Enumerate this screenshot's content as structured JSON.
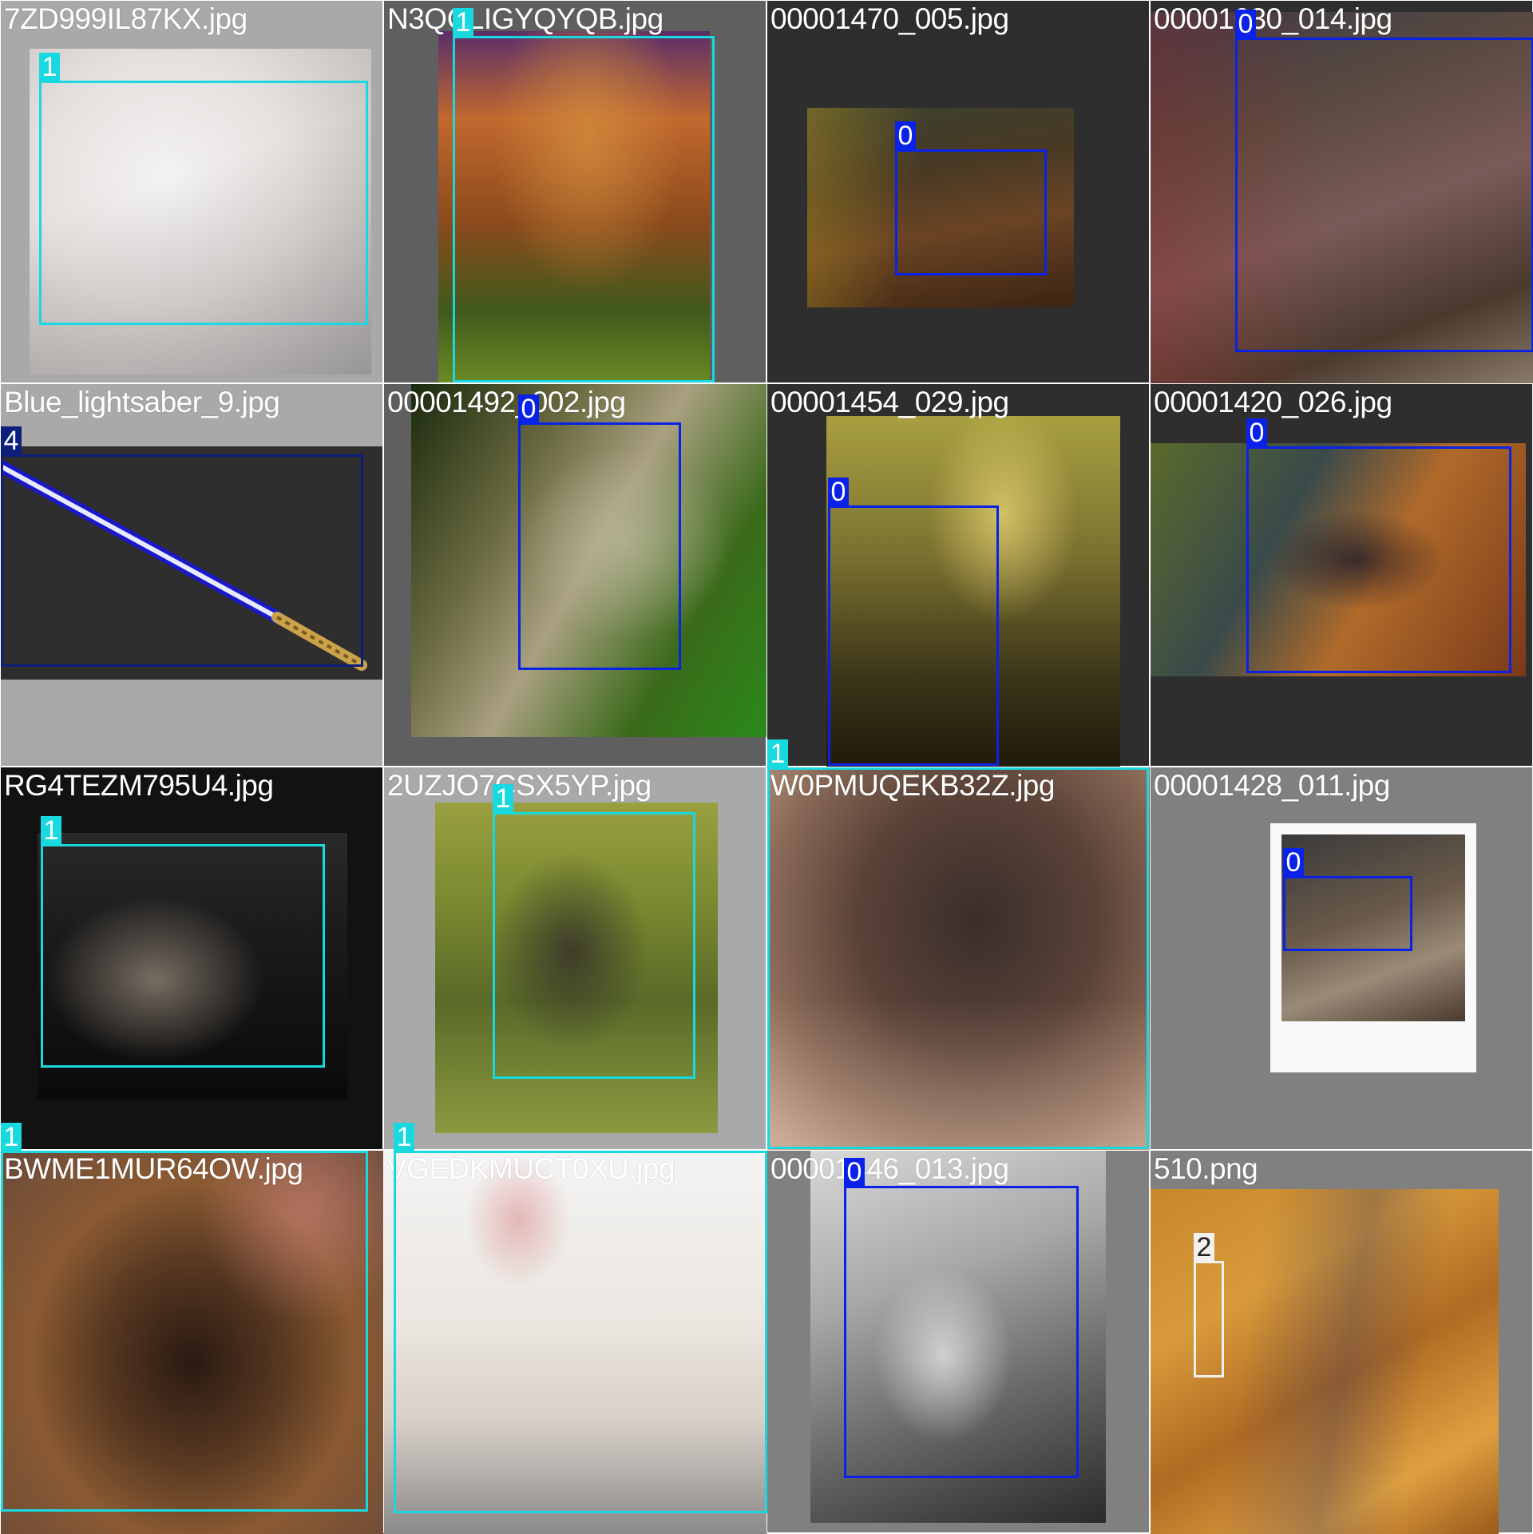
{
  "colors": {
    "cat_box": "#0a22e8",
    "dog_box": "#18d8e0",
    "lightsaber_box": "#0c1f7c",
    "person_box": "#f4f0f0"
  },
  "tiles": [
    {
      "file": "7ZD999IL87KX.jpg",
      "boxes": [
        {
          "label": "1",
          "class": "dog"
        }
      ]
    },
    {
      "file": "N3QCLIGYQYQB.jpg",
      "boxes": [
        {
          "label": "1",
          "class": "dog"
        }
      ]
    },
    {
      "file": "00001470_005.jpg",
      "boxes": [
        {
          "label": "0",
          "class": "cat"
        }
      ]
    },
    {
      "file": "00001030_014.jpg",
      "boxes": [
        {
          "label": "0",
          "class": "cat"
        }
      ]
    },
    {
      "file": "Blue_lightsaber_9.jpg",
      "boxes": [
        {
          "label": "4",
          "class": "lightsaber"
        }
      ]
    },
    {
      "file": "00001492_002.jpg",
      "boxes": [
        {
          "label": "0",
          "class": "cat"
        }
      ]
    },
    {
      "file": "00001454_029.jpg",
      "boxes": [
        {
          "label": "0",
          "class": "cat"
        }
      ]
    },
    {
      "file": "00001420_026.jpg",
      "boxes": [
        {
          "label": "0",
          "class": "cat"
        }
      ]
    },
    {
      "file": "RG4TEZM795U4.jpg",
      "boxes": [
        {
          "label": "1",
          "class": "dog"
        }
      ]
    },
    {
      "file": "2UZJO7CSX5YP.jpg",
      "boxes": [
        {
          "label": "1",
          "class": "dog"
        }
      ]
    },
    {
      "file": "W0PMUQEKB32Z.jpg",
      "boxes": [
        {
          "label": "1",
          "class": "dog"
        }
      ]
    },
    {
      "file": "00001428_011.jpg",
      "boxes": [
        {
          "label": "0",
          "class": "cat"
        }
      ]
    },
    {
      "file": "BWME1MUR64OW.jpg",
      "boxes": [
        {
          "label": "1",
          "class": "dog"
        }
      ]
    },
    {
      "file": "VGEDKMUCT0XU.jpg",
      "boxes": [
        {
          "label": "1",
          "class": "dog"
        }
      ]
    },
    {
      "file": "00001446_013.jpg",
      "boxes": [
        {
          "label": "0",
          "class": "cat"
        }
      ]
    },
    {
      "file": "510.png",
      "boxes": [
        {
          "label": "2",
          "class": "person"
        }
      ]
    }
  ]
}
